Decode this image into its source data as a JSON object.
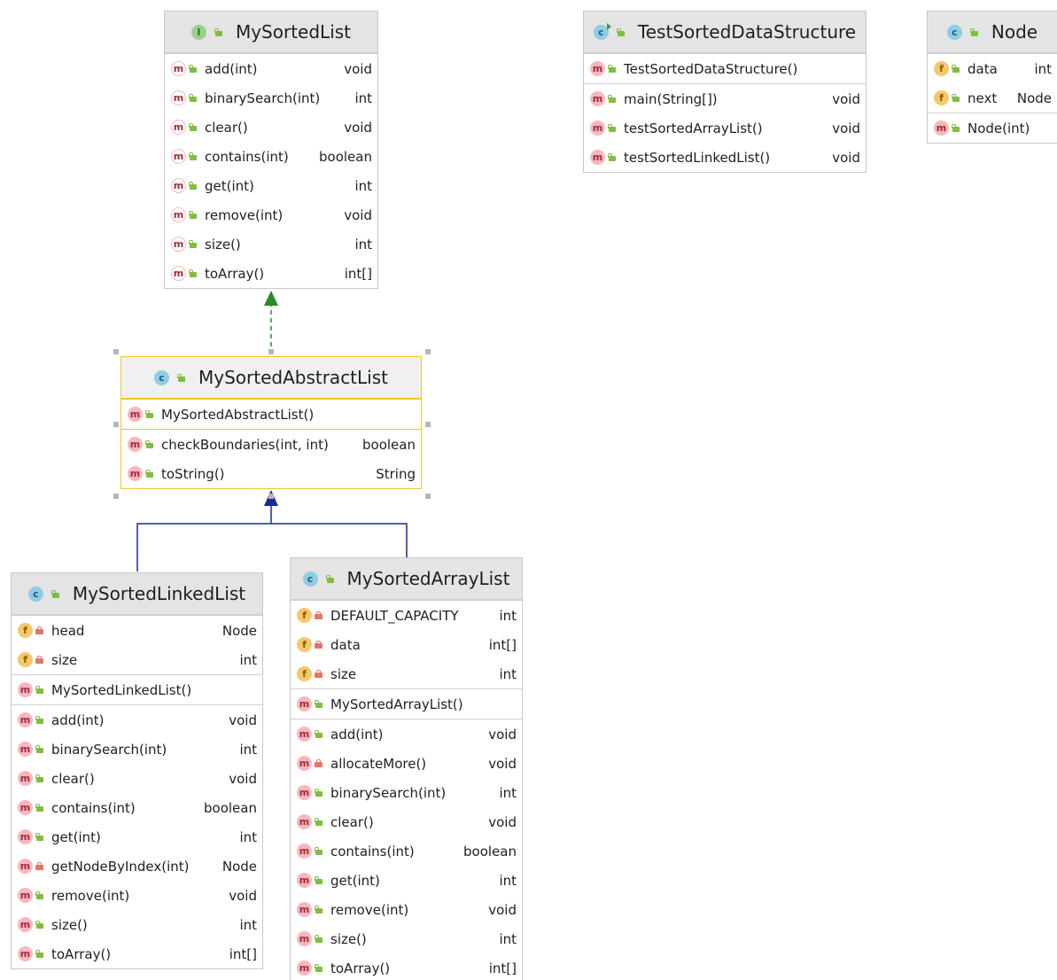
{
  "colors": {
    "realization_arrow": "#2a8a2a",
    "inheritance_arrow": "#1a2a99",
    "selected_border": "#f2c230"
  },
  "classes": {
    "my_sorted_list": {
      "kind": "interface",
      "name": "MySortedList",
      "methods": [
        {
          "name": "add(int)",
          "type": "void"
        },
        {
          "name": "binarySearch(int)",
          "type": "int"
        },
        {
          "name": "clear()",
          "type": "void"
        },
        {
          "name": "contains(int)",
          "type": "boolean"
        },
        {
          "name": "get(int)",
          "type": "int"
        },
        {
          "name": "remove(int)",
          "type": "void"
        },
        {
          "name": "size()",
          "type": "int"
        },
        {
          "name": "toArray()",
          "type": "int[]"
        }
      ]
    },
    "test_sorted_data_structure": {
      "kind": "runnable-class",
      "name": "TestSortedDataStructure",
      "constructors": [
        {
          "name": "TestSortedDataStructure()",
          "type": ""
        }
      ],
      "methods": [
        {
          "name": "main(String[])",
          "type": "void"
        },
        {
          "name": "testSortedArrayList()",
          "type": "void"
        },
        {
          "name": "testSortedLinkedList()",
          "type": "void"
        }
      ]
    },
    "node": {
      "kind": "class",
      "name": "Node",
      "fields": [
        {
          "name": "data",
          "type": "int"
        },
        {
          "name": "next",
          "type": "Node"
        }
      ],
      "constructors": [
        {
          "name": "Node(int)",
          "type": ""
        }
      ]
    },
    "my_sorted_abstract_list": {
      "kind": "abstract-class",
      "name": "MySortedAbstractList",
      "constructors": [
        {
          "name": "MySortedAbstractList()",
          "type": ""
        }
      ],
      "methods": [
        {
          "name": "checkBoundaries(int, int)",
          "type": "boolean"
        },
        {
          "name": "toString()",
          "type": "String"
        }
      ]
    },
    "my_sorted_linked_list": {
      "kind": "class",
      "name": "MySortedLinkedList",
      "fields": [
        {
          "name": "head",
          "type": "Node"
        },
        {
          "name": "size",
          "type": "int"
        }
      ],
      "constructors": [
        {
          "name": "MySortedLinkedList()",
          "type": ""
        }
      ],
      "methods": [
        {
          "name": "add(int)",
          "type": "void"
        },
        {
          "name": "binarySearch(int)",
          "type": "int"
        },
        {
          "name": "clear()",
          "type": "void"
        },
        {
          "name": "contains(int)",
          "type": "boolean"
        },
        {
          "name": "get(int)",
          "type": "int"
        },
        {
          "name": "getNodeByIndex(int)",
          "type": "Node"
        },
        {
          "name": "remove(int)",
          "type": "void"
        },
        {
          "name": "size()",
          "type": "int"
        },
        {
          "name": "toArray()",
          "type": "int[]"
        }
      ]
    },
    "my_sorted_array_list": {
      "kind": "class",
      "name": "MySortedArrayList",
      "fields": [
        {
          "name": "DEFAULT_CAPACITY",
          "type": "int"
        },
        {
          "name": "data",
          "type": "int[]"
        },
        {
          "name": "size",
          "type": "int"
        }
      ],
      "constructors": [
        {
          "name": "MySortedArrayList()",
          "type": ""
        }
      ],
      "methods": [
        {
          "name": "add(int)",
          "type": "void"
        },
        {
          "name": "allocateMore()",
          "type": "void"
        },
        {
          "name": "binarySearch(int)",
          "type": "int"
        },
        {
          "name": "clear()",
          "type": "void"
        },
        {
          "name": "contains(int)",
          "type": "boolean"
        },
        {
          "name": "get(int)",
          "type": "int"
        },
        {
          "name": "remove(int)",
          "type": "void"
        },
        {
          "name": "size()",
          "type": "int"
        },
        {
          "name": "toArray()",
          "type": "int[]"
        }
      ]
    }
  }
}
